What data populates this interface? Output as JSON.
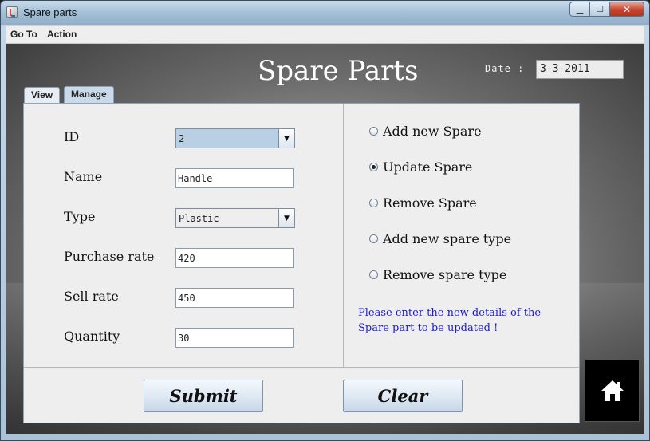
{
  "window": {
    "title": "Spare parts",
    "minimize_icon": "minimize-icon",
    "maximize_icon": "maximize-icon",
    "close_icon": "close-icon",
    "close_glyph": "✕",
    "minimize_glyph": "▁",
    "maximize_glyph": "☐"
  },
  "menubar": {
    "items": [
      "Go To",
      "Action"
    ]
  },
  "header": {
    "title": "Spare Parts",
    "date_label": "Date :",
    "date_value": "3-3-2011"
  },
  "tabs": [
    {
      "label": "View",
      "selected": false
    },
    {
      "label": "Manage",
      "selected": true
    }
  ],
  "form": {
    "id_label": "ID",
    "id_value": "2",
    "name_label": "Name",
    "name_value": "Handle",
    "type_label": "Type",
    "type_value": "Plastic",
    "purchase_label": "Purchase rate",
    "purchase_value": "420",
    "sell_label": "Sell rate",
    "sell_value": "450",
    "quantity_label": "Quantity",
    "quantity_value": "30"
  },
  "options": {
    "items": [
      {
        "label": "Add new Spare",
        "checked": false
      },
      {
        "label": "Update Spare",
        "checked": true
      },
      {
        "label": "Remove Spare",
        "checked": false
      },
      {
        "label": "Add new spare type",
        "checked": false
      },
      {
        "label": "Remove spare type",
        "checked": false
      }
    ],
    "info_text": "Please enter the new details of the Spare part to be updated !"
  },
  "buttons": {
    "submit_label": "Submit",
    "clear_label": "Clear",
    "home_icon": "home-icon"
  },
  "colors": {
    "info_text": "#1a1ad8",
    "selected_combo": "#b8cfe4"
  }
}
